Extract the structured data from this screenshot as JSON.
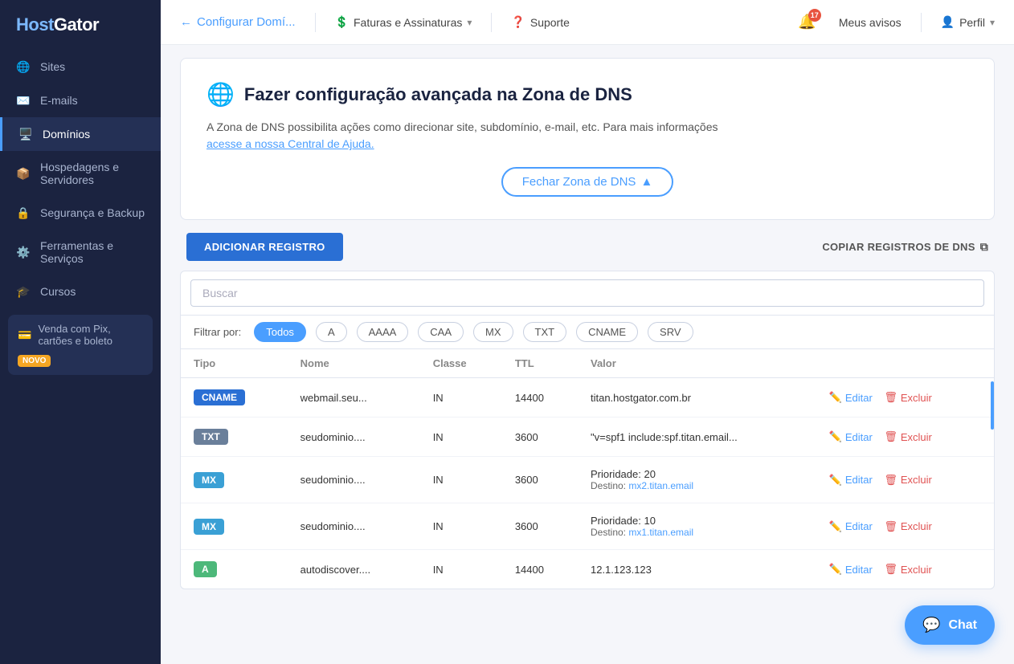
{
  "brand": {
    "name_part1": "Host",
    "name_part2": "Gator"
  },
  "sidebar": {
    "items": [
      {
        "id": "sites",
        "label": "Sites",
        "icon": "🌐"
      },
      {
        "id": "emails",
        "label": "E-mails",
        "icon": "✉️"
      },
      {
        "id": "dominios",
        "label": "Domínios",
        "icon": "🖥️",
        "active": true
      },
      {
        "id": "hospedagens",
        "label": "Hospedagens e Servidores",
        "icon": "📦"
      },
      {
        "id": "seguranca",
        "label": "Segurança e Backup",
        "icon": "🔒"
      },
      {
        "id": "ferramentas",
        "label": "Ferramentas e Serviços",
        "icon": "⚙️"
      },
      {
        "id": "cursos",
        "label": "Cursos",
        "icon": "🎓"
      }
    ],
    "pix_item": {
      "label": "Venda com Pix, cartões e boleto",
      "badge": "NOVO"
    }
  },
  "topbar": {
    "back_label": "Configurar Domí...",
    "faturas_label": "Faturas e Assinaturas",
    "suporte_label": "Suporte",
    "avisos_label": "Meus avisos",
    "avisos_count": "17",
    "perfil_label": "Perfil"
  },
  "dns_section": {
    "icon": "🌐",
    "title": "Fazer configuração avançada na Zona de DNS",
    "description": "A Zona de DNS possibilita ações como direcionar site, subdomínio, e-mail, etc. Para mais informações",
    "help_link": "acesse a nossa Central de Ajuda.",
    "close_button": "Fechar Zona de DNS"
  },
  "actions": {
    "add_button": "ADICIONAR REGISTRO",
    "copy_button": "COPIAR REGISTROS DE DNS"
  },
  "search": {
    "placeholder": "Buscar"
  },
  "filters": {
    "label": "Filtrar por:",
    "items": [
      {
        "id": "todos",
        "label": "Todos",
        "active": true
      },
      {
        "id": "a",
        "label": "A",
        "active": false
      },
      {
        "id": "aaaa",
        "label": "AAAA",
        "active": false
      },
      {
        "id": "caa",
        "label": "CAA",
        "active": false
      },
      {
        "id": "mx",
        "label": "MX",
        "active": false
      },
      {
        "id": "txt",
        "label": "TXT",
        "active": false
      },
      {
        "id": "cname",
        "label": "CNAME",
        "active": false
      },
      {
        "id": "srv",
        "label": "SRV",
        "active": false
      }
    ]
  },
  "table": {
    "headers": [
      "Tipo",
      "Nome",
      "Classe",
      "TTL",
      "Valor"
    ],
    "rows": [
      {
        "type": "CNAME",
        "type_class": "type-cname",
        "name": "webmail.seu...",
        "class": "IN",
        "ttl": "14400",
        "value": "titan.hostgator.com.br",
        "value2": null
      },
      {
        "type": "TXT",
        "type_class": "type-txt",
        "name": "seudominio....",
        "class": "IN",
        "ttl": "3600",
        "value": "\"v=spf1 include:spf.titan.email...",
        "value2": null
      },
      {
        "type": "MX",
        "type_class": "type-mx",
        "name": "seudominio....",
        "class": "IN",
        "ttl": "3600",
        "value": "Prioridade: 20",
        "value2": "Destino: mx2.titan.email"
      },
      {
        "type": "MX",
        "type_class": "type-mx",
        "name": "seudominio....",
        "class": "IN",
        "ttl": "3600",
        "value": "Prioridade: 10",
        "value2": "Destino: mx1.titan.email"
      },
      {
        "type": "A",
        "type_class": "type-a",
        "name": "autodiscover....",
        "class": "IN",
        "ttl": "14400",
        "value": "12.1.123.123",
        "value2": null
      }
    ]
  },
  "chat": {
    "label": "Chat"
  }
}
